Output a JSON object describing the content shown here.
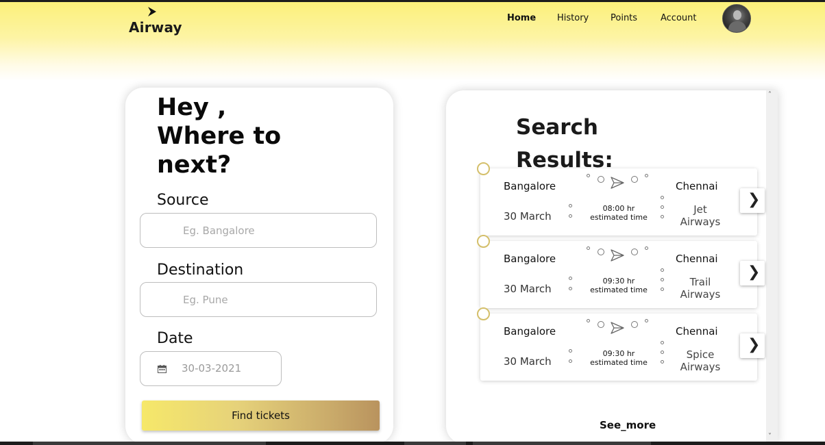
{
  "brand": {
    "name": "Airway",
    "logo_icon": "chevron-right-icon"
  },
  "nav": {
    "items": [
      {
        "label": "Home",
        "active": true
      },
      {
        "label": "History",
        "active": false
      },
      {
        "label": "Points",
        "active": false
      },
      {
        "label": "Account",
        "active": false
      }
    ],
    "avatar": "user-avatar"
  },
  "search": {
    "greeting_line1": "Hey ,",
    "greeting_line2": "Where to",
    "greeting_line3": "next?",
    "source_label": "Source",
    "source_placeholder": "Eg. Bangalore",
    "destination_label": "Destination",
    "destination_placeholder": "Eg. Pune",
    "date_label": "Date",
    "date_value": "30-03-2021",
    "date_icon": "calendar-icon",
    "find_button": "Find tickets"
  },
  "results": {
    "title_line1": "Search",
    "title_line2": "Results:",
    "see_more": "See_more",
    "items": [
      {
        "source": "Bangalore",
        "destination": "Chennai",
        "date": "30 March",
        "time": "08:00 hr",
        "estimate_label": "estimated time",
        "airline_line1": "Jet",
        "airline_line2": "Airways"
      },
      {
        "source": "Bangalore",
        "destination": "Chennai",
        "date": "30 March",
        "time": "09:30 hr",
        "estimate_label": "estimated time",
        "airline_line1": "Trail",
        "airline_line2": "Airways"
      },
      {
        "source": "Bangalore",
        "destination": "Chennai",
        "date": "30 March",
        "time": "09:30 hr",
        "estimate_label": "estimated time",
        "airline_line1": "Spice",
        "airline_line2": "Airways"
      }
    ]
  },
  "colors": {
    "header_yellow": "#fbf07a",
    "button_start": "#f6e86a",
    "button_end": "#b9935e",
    "pin_gold": "#d4bf6a"
  }
}
